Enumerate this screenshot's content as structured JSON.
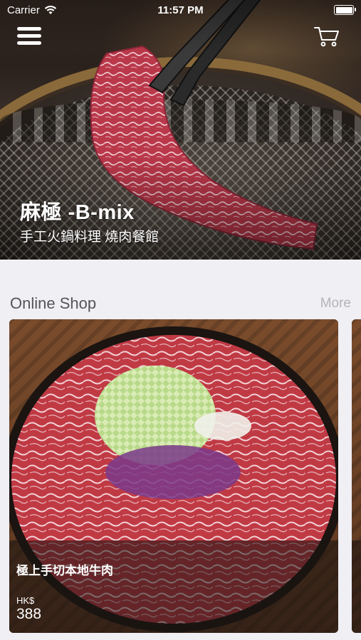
{
  "status_bar": {
    "carrier": "Carrier",
    "time": "11:57 PM",
    "wifi_icon": "wifi-icon",
    "battery_icon": "battery-icon"
  },
  "nav": {
    "menu_icon": "hamburger-menu-icon",
    "cart_icon": "shopping-cart-icon"
  },
  "hero": {
    "title": "麻極 -B-mix",
    "subtitle": "手工火鍋料理 燒肉餐館"
  },
  "online_shop": {
    "section_title": "Online Shop",
    "more_label": "More",
    "products": [
      {
        "name": "極上手切本地牛肉",
        "currency": "HK$",
        "price": "388"
      }
    ]
  },
  "colors": {
    "background": "#efeff4",
    "section_title": "#555555",
    "more_link": "#b5b5b8",
    "overlay_text": "#ffffff"
  }
}
